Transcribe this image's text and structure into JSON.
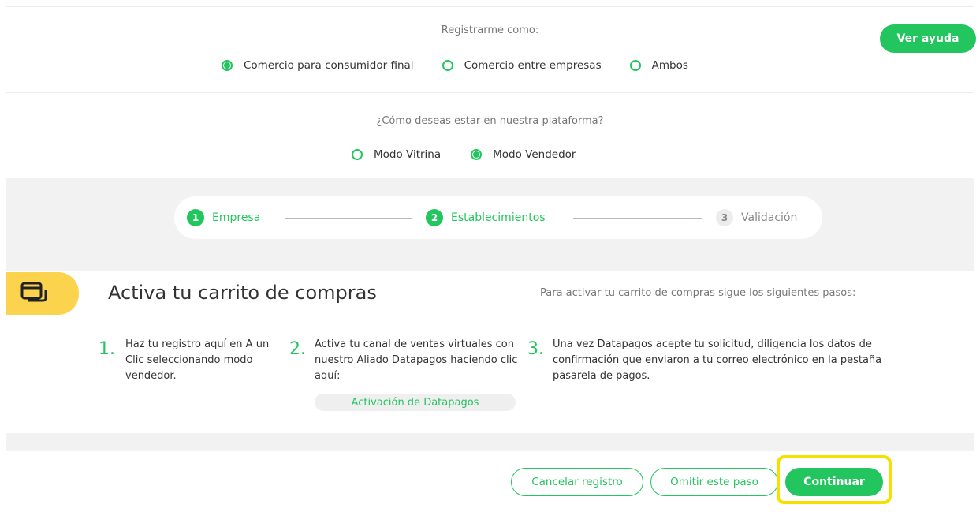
{
  "register": {
    "question": "Registrarme como:",
    "options": [
      {
        "label": "Comercio para consumidor final",
        "selected": true
      },
      {
        "label": "Comercio entre empresas",
        "selected": false
      },
      {
        "label": "Ambos",
        "selected": false
      }
    ]
  },
  "help_button": "Ver ayuda",
  "platform": {
    "question": "¿Cómo deseas estar en nuestra plataforma?",
    "options": [
      {
        "label": "Modo Vitrina",
        "selected": false
      },
      {
        "label": "Modo Vendedor",
        "selected": true
      }
    ]
  },
  "stepper": [
    {
      "num": "1",
      "label": "Empresa",
      "state": "done"
    },
    {
      "num": "2",
      "label": "Establecimientos",
      "state": "active"
    },
    {
      "num": "3",
      "label": "Validación",
      "state": "pending"
    }
  ],
  "cart": {
    "icon": "cart-window-icon",
    "title": "Activa tu carrito de compras",
    "intro": "Para activar tu carrito de compras sigue los siguientes pasos:",
    "steps": [
      {
        "num": "1.",
        "text": "Haz tu registro aquí en A un Clic seleccionando modo vendedor."
      },
      {
        "num": "2.",
        "text": "Activa tu canal de ventas virtuales con nuestro Aliado Datapagos haciendo clic aquí:"
      },
      {
        "num": "3.",
        "text": "Una vez Datapagos acepte tu solicitud, diligencia los datos de confirmación que enviaron a tu correo electrónico en la pestaña pasarela de pagos."
      }
    ],
    "link": "Activación de Datapagos"
  },
  "actions": {
    "cancel": "Cancelar registro",
    "skip": "Omitir este paso",
    "continue": "Continuar"
  },
  "colors": {
    "accent": "#22c55e",
    "tag": "#fcd34d",
    "highlight": "#f5e000"
  }
}
